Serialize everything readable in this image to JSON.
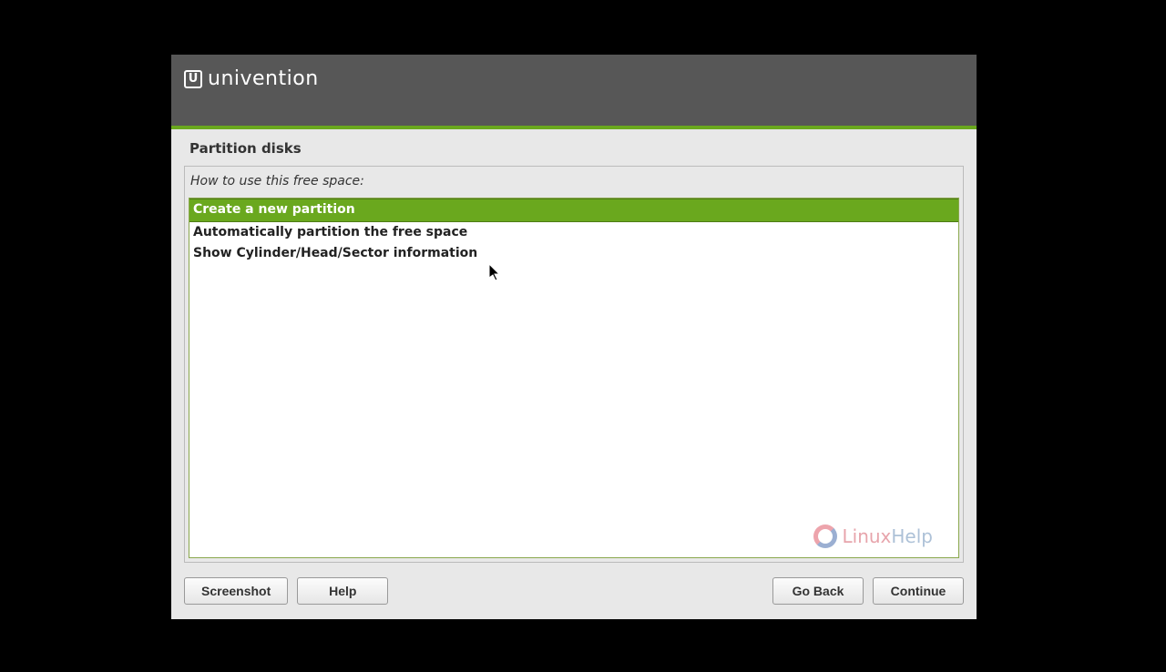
{
  "header": {
    "brand": "univention"
  },
  "title": "Partition disks",
  "prompt": "How to use this free space:",
  "options": [
    {
      "label": "Create a new partition",
      "selected": true
    },
    {
      "label": "Automatically partition the free space",
      "selected": false
    },
    {
      "label": "Show Cylinder/Head/Sector information",
      "selected": false
    }
  ],
  "watermark": {
    "part1": "Linux",
    "part2": "Help"
  },
  "buttons": {
    "screenshot": "Screenshot",
    "help": "Help",
    "go_back": "Go Back",
    "continue": "Continue"
  }
}
